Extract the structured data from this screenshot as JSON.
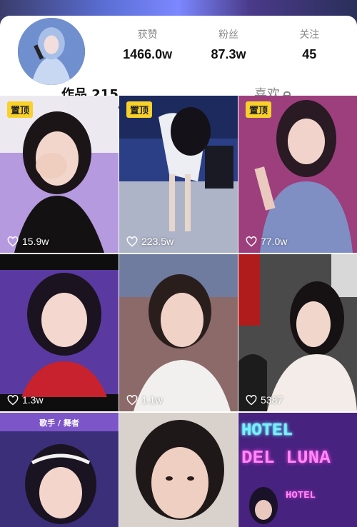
{
  "profile": {
    "stats": [
      {
        "label": "获赞",
        "value": "1466.0w"
      },
      {
        "label": "粉丝",
        "value": "87.3w"
      },
      {
        "label": "关注",
        "value": "45"
      }
    ]
  },
  "tabs": {
    "works_label": "作品 215",
    "likes_label": "喜欢"
  },
  "videos": [
    {
      "pinned": true,
      "pin_label": "置顶",
      "likes": "15.9w"
    },
    {
      "pinned": true,
      "pin_label": "置顶",
      "likes": "223.5w"
    },
    {
      "pinned": true,
      "pin_label": "置顶",
      "likes": "77.0w"
    },
    {
      "pinned": false,
      "likes": "1.3w"
    },
    {
      "pinned": false,
      "likes": "1.1w"
    },
    {
      "pinned": false,
      "likes": "5387"
    },
    {
      "pinned": false,
      "caption": "歌手 / 舞者"
    },
    {
      "pinned": false
    },
    {
      "pinned": false,
      "overlay_line1": "HOTEL",
      "overlay_line2": "DEL LUNA",
      "overlay_line3": "HOTEL"
    }
  ],
  "colors": {
    "pin_background": "#f8d12a",
    "active_tab": "#111111",
    "inactive_tab": "#888888",
    "neon": "#7af0ff"
  }
}
